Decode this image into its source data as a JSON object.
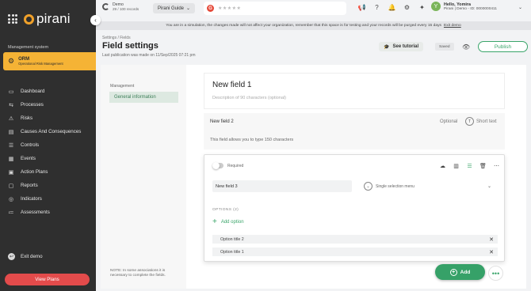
{
  "sidebar": {
    "brand": "pirani",
    "section_label": "Management system",
    "module": {
      "title": "ORM",
      "subtitle": "Operational Risk Management"
    },
    "items": [
      {
        "label": "Dashboard",
        "icon": "monitor-icon"
      },
      {
        "label": "Processes",
        "icon": "processes-icon"
      },
      {
        "label": "Risks",
        "icon": "alert-icon"
      },
      {
        "label": "Causes And Consequences",
        "icon": "causes-icon"
      },
      {
        "label": "Controls",
        "icon": "sliders-icon"
      },
      {
        "label": "Events",
        "icon": "events-icon"
      },
      {
        "label": "Action Plans",
        "icon": "action-plans-icon"
      },
      {
        "label": "Reports",
        "icon": "reports-icon"
      },
      {
        "label": "Indicators",
        "icon": "indicators-icon"
      },
      {
        "label": "Assessments",
        "icon": "assessments-icon"
      }
    ],
    "exit_label": "Exit demo",
    "view_plans_label": "View Plans"
  },
  "topbar": {
    "demo_title": "Demo",
    "demo_records": "29 / 100 records",
    "guide_label": "Pirani Guide",
    "g_badge": "G",
    "stars": "★★★★★",
    "user_initial": "Y",
    "user_name": "Hello, Yomira",
    "user_org": "Pirani | Demo - ID: 0000000411"
  },
  "banner": {
    "text": "You are in a simulation, the changes made will not affect your organization, remember that this space is for testing and your records will be purged every 15 days",
    "link": "Exit demo"
  },
  "header": {
    "breadcrumb": "Settings / Fields",
    "title": "Field settings",
    "last_publication": "Last publication was made on 11/Sep/2025 07:21 pm",
    "tutorial_label": "See tutorial",
    "saved_label": "Saved",
    "publish_label": "Publish"
  },
  "left_panel": {
    "section_label": "Management",
    "item_label": "General information",
    "note": "NOTE: In some associations it is necessary to complete the fields."
  },
  "form": {
    "title": "New field 1",
    "description_placeholder": "Description of 90 characters (optional)"
  },
  "field2": {
    "name": "New field 2",
    "optional_label": "Optional",
    "type_label": "Short text",
    "help_text": "This field allows you to type 150 characters"
  },
  "edit_field": {
    "required_label": "Required",
    "name_value": "New field 3",
    "type_value": "Single selection menu",
    "options_label": "OPTIONS (2)",
    "add_option_label": "Add option",
    "options": [
      "Option title 2",
      "Option title 1"
    ]
  },
  "actions": {
    "add_label": "Add",
    "more_label": "•••"
  },
  "colors": {
    "accent_green": "#36a168",
    "brand_orange": "#f5b335",
    "danger_red": "#e34b4b",
    "sidebar_bg": "#2f2f2f"
  }
}
